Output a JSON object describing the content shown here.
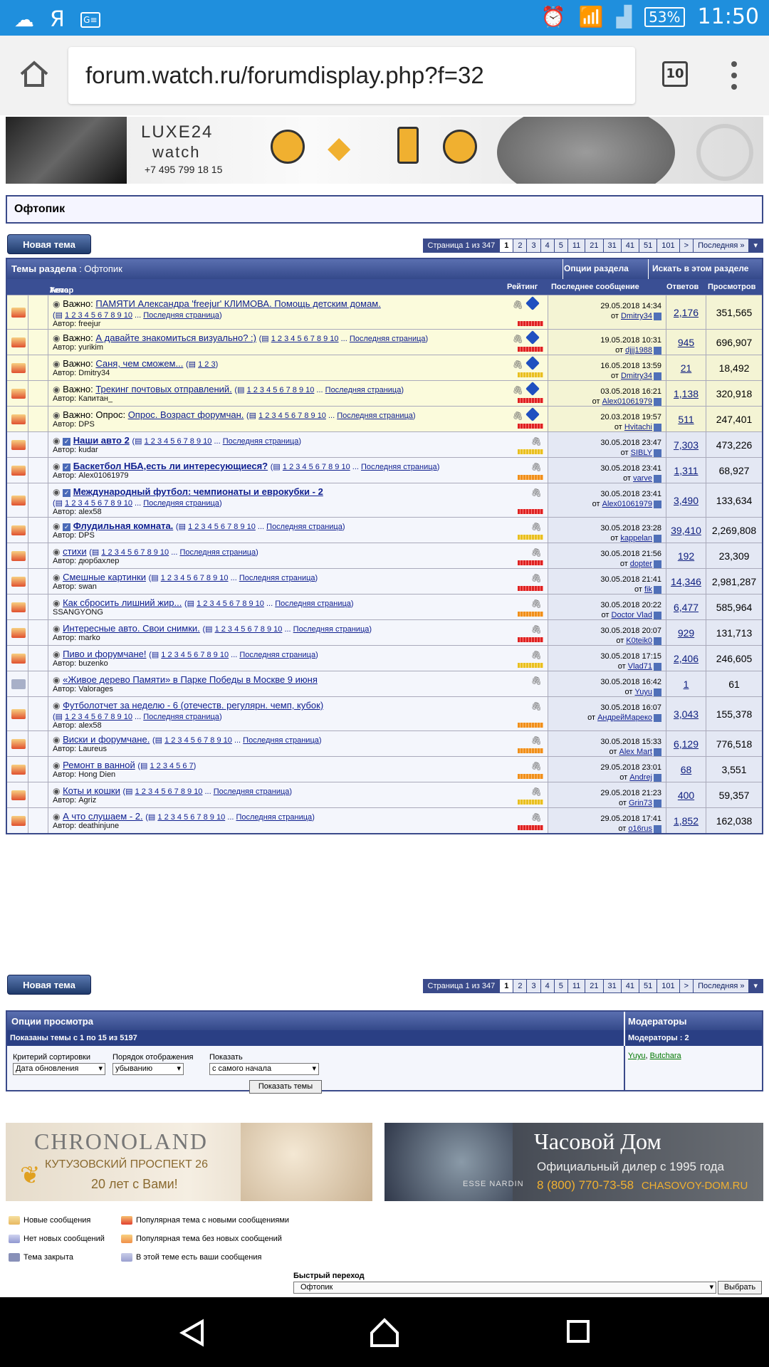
{
  "status": {
    "clock": "11:50",
    "battery": "53%",
    "ya": "Я"
  },
  "browser": {
    "url": "forum.watch.ru/forumdisplay.php?f=32",
    "tabs": "10"
  },
  "banner": {
    "logo1": "LUXE24",
    "logo2": "watch",
    "phone": "+7 495 799 18 15"
  },
  "forum": {
    "title": "Офтопик",
    "new_topic": "Новая тема"
  },
  "pager": {
    "label": "Страница 1 из 347",
    "pages": [
      "1",
      "2",
      "3",
      "4",
      "5",
      "11",
      "21",
      "31",
      "41",
      "51",
      "101",
      ">",
      "Последняя »"
    ]
  },
  "table": {
    "header": "Темы раздела",
    "header_forum": ": Офтопик",
    "options": "Опции раздела",
    "search": "Искать в этом разделе",
    "cols": {
      "topic": "Тема",
      "sep": " / ",
      "author": "Автор",
      "rating": "Рейтинг",
      "last": "Последнее сообщение",
      "replies": "Ответов",
      "views": "Просмотров"
    }
  },
  "topics": [
    {
      "prefix": "Важно: ",
      "title": "ПАМЯТИ Александра 'freejur' КЛИМОВА. Помощь детским домам.",
      "pages": "1 2 3 4 5 6 7 8 9 10",
      "last_page": "Последняя страница",
      "author": "Автор: freejur",
      "date": "29.05.2018 14:34",
      "by": "Dmitry34",
      "replies": "2,176",
      "views": "351,565",
      "sticky": true,
      "rating": "r",
      "pin": true,
      "twoline": true
    },
    {
      "prefix": "Важно: ",
      "title": "А давайте знакомиться визуально? :)",
      "pages": "1 2 3 4 5 6 7 8 9 10",
      "last_page": "Последняя страница",
      "author": "Автор: yurikim",
      "date": "19.05.2018 10:31",
      "by": "djjj1988",
      "replies": "945",
      "views": "696,907",
      "sticky": true,
      "rating": "r",
      "pin": true
    },
    {
      "prefix": "Важно: ",
      "title": "Саня, чем сможем...",
      "pages": "1 2 3",
      "last_page": "",
      "author": "Автор: Dmitry34",
      "date": "16.05.2018 13:59",
      "by": "Dmitry34",
      "replies": "21",
      "views": "18,492",
      "sticky": true,
      "rating": "y",
      "pin": true
    },
    {
      "prefix": "Важно: ",
      "title": "Трекинг почтовых отправлений.",
      "pages": "1 2 3 4 5 6 7 8 9 10",
      "last_page": "Последняя страница",
      "author": "Автор: Капитан_",
      "date": "03.05.2018 16:21",
      "by": "Alex01061979",
      "replies": "1,138",
      "views": "320,918",
      "sticky": true,
      "rating": "r",
      "pin": true
    },
    {
      "prefix": "Важно: Опрос: ",
      "title": "Опрос. Возраст форумчан.",
      "pages": "1 2 3 4 5 6 7 8 9 10",
      "last_page": "Последняя страница",
      "author": "Автор: DPS",
      "date": "20.03.2018 19:57",
      "by": "Hvitachi",
      "replies": "511",
      "views": "247,401",
      "sticky": true,
      "rating": "r",
      "pin": true
    },
    {
      "prefix": "",
      "title": "Наши авто 2",
      "pages": "1 2 3 4 5 6 7 8 9 10",
      "last_page": "Последняя страница",
      "author": "Автор: kudar",
      "date": "30.05.2018 23:47",
      "by": "SIBLY",
      "replies": "7,303",
      "views": "473,226",
      "bold": true,
      "rating": "y"
    },
    {
      "prefix": "",
      "title": "Баскетбол НБА,есть ли интересующиеся?",
      "pages": "1 2 3 4 5 6 7 8 9 10",
      "last_page": "Последняя страница",
      "author": "Автор: Alex01061979",
      "date": "30.05.2018 23:41",
      "by": "varve",
      "replies": "1,311",
      "views": "68,927",
      "bold": true,
      "rating": "o"
    },
    {
      "prefix": "",
      "title": "Международный футбол: чемпионаты и еврокубки - 2",
      "pages": "1 2 3 4 5 6 7 8 9 10",
      "last_page": "Последняя страница",
      "author": "Автор: alex58",
      "date": "30.05.2018 23:41",
      "by": "Alex01061979",
      "replies": "3,490",
      "views": "133,634",
      "bold": true,
      "rating": "r",
      "twoline": true
    },
    {
      "prefix": "",
      "title": "Флудильная комната.",
      "pages": "1 2 3 4 5 6 7 8 9 10",
      "last_page": "Последняя страница",
      "author": "Автор: DPS",
      "date": "30.05.2018 23:28",
      "by": "kappelan",
      "replies": "39,410",
      "views": "2,269,808",
      "bold": true,
      "rating": "y"
    },
    {
      "prefix": "",
      "title": "стихи",
      "pages": "1 2 3 4 5 6 7 8 9 10",
      "last_page": "Последняя страница",
      "author": "Автор: дюрбахлер",
      "date": "30.05.2018 21:56",
      "by": "dopter",
      "replies": "192",
      "views": "23,309",
      "rating": "r"
    },
    {
      "prefix": "",
      "title": "Смешные картинки",
      "pages": "1 2 3 4 5 6 7 8 9 10",
      "last_page": "Последняя страница",
      "author": "Автор: swan",
      "date": "30.05.2018 21:41",
      "by": "fik",
      "replies": "14,346",
      "views": "2,981,287",
      "rating": "r"
    },
    {
      "prefix": "",
      "title": "Как сбросить лишний жир...",
      "pages": "1 2 3 4 5 6 7 8 9 10",
      "last_page": "Последняя страница",
      "author": "SSANGYONG",
      "date": "30.05.2018 20:22",
      "by": "Doctor Vlad",
      "replies": "6,477",
      "views": "585,964",
      "rating": "o"
    },
    {
      "prefix": "",
      "title": "Интересные авто. Свои снимки.",
      "pages": "1 2 3 4 5 6 7 8 9 10",
      "last_page": "Последняя страница",
      "author": "Автор: marko",
      "date": "30.05.2018 20:07",
      "by": "K0teik0",
      "replies": "929",
      "views": "131,713",
      "rating": "r"
    },
    {
      "prefix": "",
      "title": "Пиво и форумчане!",
      "pages": "1 2 3 4 5 6 7 8 9 10",
      "last_page": "Последняя страница",
      "author": "Автор: buzenko",
      "date": "30.05.2018 17:15",
      "by": "Vlad71",
      "replies": "2,406",
      "views": "246,605",
      "rating": "y"
    },
    {
      "prefix": "",
      "title": "«Живое дерево Памяти» в Парке Победы в Москве 9 июня",
      "pages": "",
      "last_page": "",
      "author": "Автор: Valorages",
      "date": "30.05.2018 16:42",
      "by": "Yuyu",
      "replies": "1",
      "views": "61",
      "rating": "",
      "lock": true
    },
    {
      "prefix": "",
      "title": "Футболотчет за неделю - 6 (отечеств. регулярн. чемп, кубок)",
      "pages": "1 2 3 4 5 6 7 8 9 10",
      "last_page": "Последняя страница",
      "author": "Автор: alex58",
      "date": "30.05.2018 16:07",
      "by": "АндрейМарeко",
      "replies": "3,043",
      "views": "155,378",
      "rating": "o",
      "twoline": true
    },
    {
      "prefix": "",
      "title": "Виски и форумчане.",
      "pages": "1 2 3 4 5 6 7 8 9 10",
      "last_page": "Последняя страница",
      "author": "Автор: Laureus",
      "date": "30.05.2018 15:33",
      "by": "Alex Mart",
      "replies": "6,129",
      "views": "776,518",
      "rating": "o"
    },
    {
      "prefix": "",
      "title": "Ремонт в ванной",
      "pages": "1 2 3 4 5 6 7",
      "last_page": "",
      "author": "Автор: Hong Dien",
      "date": "29.05.2018 23:01",
      "by": "Andrej",
      "replies": "68",
      "views": "3,551",
      "rating": "o"
    },
    {
      "prefix": "",
      "title": "Коты и кошки",
      "pages": "1 2 3 4 5 6 7 8 9 10",
      "last_page": "Последняя страница",
      "author": "Автор: Agriz",
      "date": "29.05.2018 21:23",
      "by": "Grin73",
      "replies": "400",
      "views": "59,357",
      "rating": "y"
    },
    {
      "prefix": "",
      "title": "А что слушаем - 2.",
      "pages": "1 2 3 4 5 6 7 8 9 10",
      "last_page": "Последняя страница",
      "author": "Автор: deathinjune",
      "date": "29.05.2018 17:41",
      "by": "o16rus",
      "replies": "1,852",
      "views": "162,038",
      "rating": "r"
    }
  ],
  "from": "от",
  "options": {
    "title": "Опции просмотра",
    "shown": "Показаны темы с 1 по 15 из 5197",
    "sort_label": "Критерий сортировки",
    "sort_value": "Дата обновления",
    "order_label": "Порядок отображения",
    "order_value": "убыванию",
    "show_label": "Показать",
    "show_value": "с самого начала",
    "button": "Показать темы",
    "mods_title": "Модераторы",
    "mods_count": "Модераторы : 2",
    "mod1": "Yuyu",
    "mod_sep": ", ",
    "mod2": "Butchara"
  },
  "ads": {
    "left_brand": "CHRONOLAND",
    "left_addr": "КУТУЗОВСКИЙ ПРОСПЕКТ 26",
    "left_years": "20 лет с Вами!",
    "right_brand": "Часовой Дом",
    "right_sub": "Официальный дилер с 1995 года",
    "right_phone": "8 (800) 770-73-58",
    "right_site": "CHASOVOY-DOM.RU",
    "right_watch_text": "ESSE NARDIN"
  },
  "legend": [
    "Новые сообщения",
    "Популярная тема с новыми сообщениями",
    "Нет новых сообщений",
    "Популярная тема без новых сообщений",
    "Тема закрыта",
    "В этой теме есть ваши сообщения"
  ],
  "quickjump": {
    "label": "Быстрый переход",
    "value": "Офтопик",
    "button": "Выбрать"
  }
}
